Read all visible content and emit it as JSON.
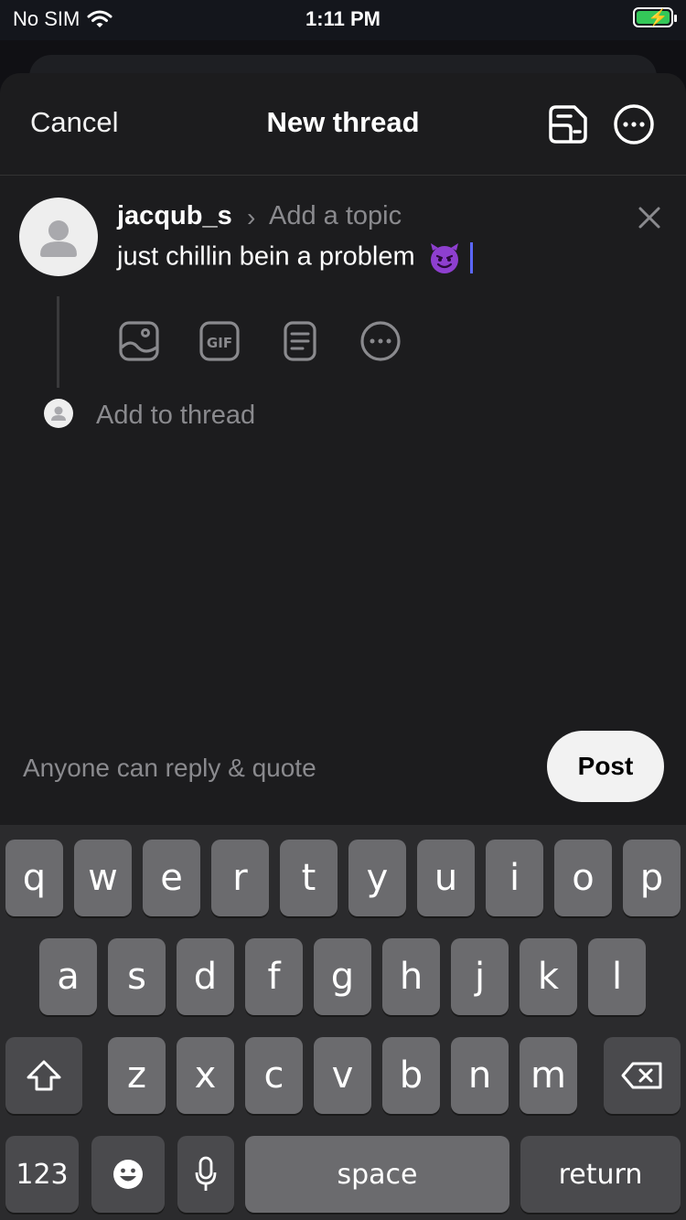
{
  "status_bar": {
    "carrier": "No SIM",
    "time": "1:11 PM"
  },
  "header": {
    "cancel": "Cancel",
    "title": "New thread"
  },
  "post": {
    "username": "jacqub_s",
    "topic_placeholder": "Add a topic",
    "text": "just chillin bein a problem",
    "emoji": "smiling-imp-emoji"
  },
  "add_thread": "Add to thread",
  "reply_setting": "Anyone can reply & quote",
  "post_button": "Post",
  "keyboard": {
    "row1": [
      "q",
      "w",
      "e",
      "r",
      "t",
      "y",
      "u",
      "i",
      "o",
      "p"
    ],
    "row2": [
      "a",
      "s",
      "d",
      "f",
      "g",
      "h",
      "j",
      "k",
      "l"
    ],
    "row3": [
      "z",
      "x",
      "c",
      "v",
      "b",
      "n",
      "m"
    ],
    "numbers": "123",
    "space": "space",
    "return": "return"
  },
  "colors": {
    "sheet": "#1c1c1e",
    "caret": "#5b67ff",
    "battery": "#34c759"
  }
}
